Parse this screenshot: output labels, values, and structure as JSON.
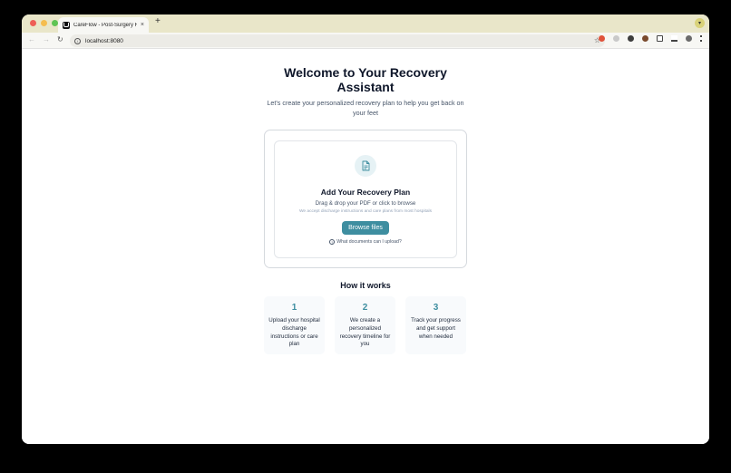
{
  "browser": {
    "tab_title": "CareFlow - Post-Surgery Rec",
    "tab_close": "×",
    "new_tab": "+",
    "url": "localhost:8080"
  },
  "hero": {
    "title": "Welcome to Your Recovery Assistant",
    "subtitle": "Let's create your personalized recovery plan to help you get back on your feet"
  },
  "upload": {
    "title": "Add Your Recovery Plan",
    "subtitle": "Drag & drop your PDF or click to browse",
    "note": "We accept discharge instructions and care plans from most hospitals",
    "button": "Browse files",
    "help_link": "What documents can I upload?"
  },
  "how_it_works": {
    "title": "How it works",
    "steps": [
      {
        "number": "1",
        "text": "Upload your hospital discharge instructions or care plan"
      },
      {
        "number": "2",
        "text": "We create a personalized recovery timeline for you"
      },
      {
        "number": "3",
        "text": "Track your progress and get support when needed"
      }
    ]
  },
  "colors": {
    "accent": "#3e8ea0",
    "tabbar": "#e9e6c9"
  }
}
